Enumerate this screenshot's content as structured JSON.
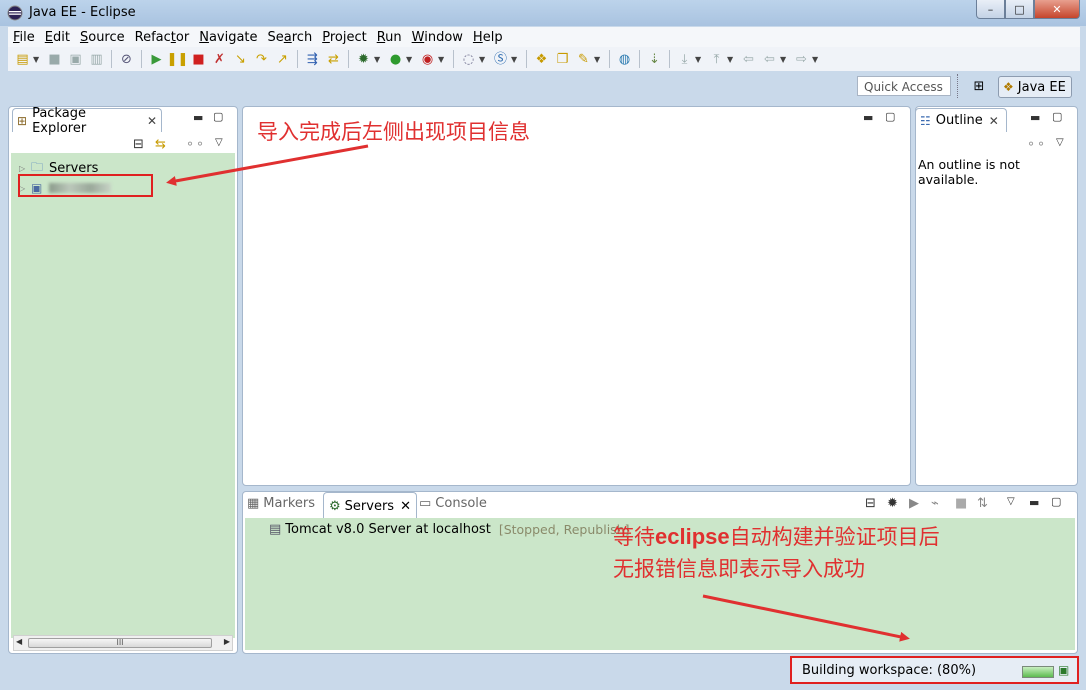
{
  "window": {
    "title": "Java EE - Eclipse",
    "buttons": {
      "minimize": "–",
      "maximize": "□",
      "close": "✕"
    }
  },
  "menu": [
    {
      "mnemonic": "F",
      "rest": "ile"
    },
    {
      "mnemonic": "E",
      "rest": "dit"
    },
    {
      "mnemonic": "S",
      "rest": "ource"
    },
    {
      "pre": "Refac",
      "mnemonic": "t",
      "rest": "or"
    },
    {
      "mnemonic": "N",
      "rest": "avigate"
    },
    {
      "pre": "Se",
      "mnemonic": "a",
      "rest": "rch"
    },
    {
      "mnemonic": "P",
      "rest": "roject"
    },
    {
      "mnemonic": "R",
      "rest": "un"
    },
    {
      "mnemonic": "W",
      "rest": "indow"
    },
    {
      "mnemonic": "H",
      "rest": "elp"
    }
  ],
  "toolbar": {
    "quick_access": "Quick Access",
    "perspective": "Java EE"
  },
  "package_explorer": {
    "tab_label": "Package Explorer",
    "items": [
      {
        "label": "Servers",
        "icon": "folder-icon"
      },
      {
        "label": "",
        "icon": "project-icon",
        "blurred": true
      }
    ],
    "scroll_grip": "III"
  },
  "outline": {
    "tab_label": "Outline",
    "message": "An outline is not available."
  },
  "bottom_panel": {
    "tabs": [
      {
        "label": "Markers",
        "active": false
      },
      {
        "label": "Servers",
        "active": true
      },
      {
        "label": "Console",
        "active": false
      }
    ],
    "server_row": {
      "name": "Tomcat v8.0 Server at localhost",
      "state": "[Stopped, Republish]"
    }
  },
  "status": {
    "text": "Building workspace: (80%)",
    "progress": 0.8
  },
  "annotations": {
    "top": "导入完成后左侧出现项目信息",
    "bottom_line1_pre": "等待",
    "bottom_line1_brand": "eclipse",
    "bottom_line1_post": "自动构建并验证项目后",
    "bottom_line2": "无报错信息即表示导入成功"
  },
  "colors": {
    "annotation": "#e03030",
    "panel_green": "#cbe6c9",
    "window_bg": "#c9d9ea"
  }
}
